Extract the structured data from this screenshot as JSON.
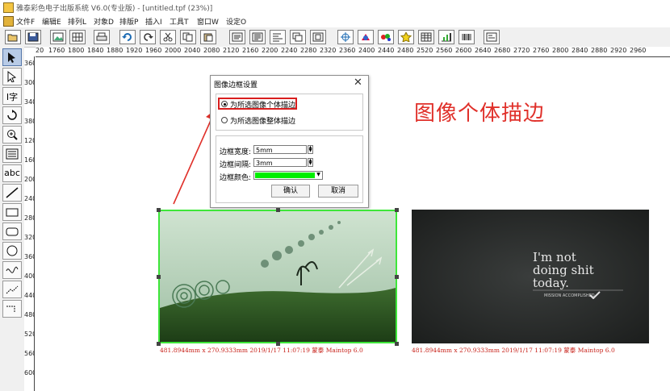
{
  "window": {
    "title": "雅泰彩色电子出版系统 V6.0(专业版) - [untitled.tpf (23%)]"
  },
  "menu": [
    "文件F",
    "编辑E",
    "排列L",
    "对象D",
    "排版P",
    "插入I",
    "工具T",
    "窗口W",
    "设定O"
  ],
  "toolbar": {
    "icons": [
      "open-folder-icon",
      "save-icon",
      "image-icon",
      "grid-icon",
      "print-icon",
      "undo-icon",
      "redo-icon",
      "cut-icon",
      "copy-icon",
      "paste-icon",
      "text-frame-icon",
      "text-flow-icon",
      "align-icon",
      "layers-icon",
      "group-icon",
      "crosshair-icon",
      "color-wheel-icon",
      "palette-icon",
      "star-icon",
      "table-icon",
      "chart-icon",
      "barcode-icon",
      "preview-icon"
    ]
  },
  "ruler": {
    "horizontal": [
      "20",
      "1760",
      "1800",
      "1840",
      "1880",
      "1920",
      "1960",
      "2000",
      "2040",
      "2080",
      "2120",
      "2160",
      "2200",
      "2240",
      "2280",
      "2320",
      "2360",
      "2400",
      "2440",
      "2480",
      "2520",
      "2560",
      "2600",
      "2640",
      "2680",
      "2720",
      "2760",
      "2800",
      "2840",
      "2880",
      "2920",
      "2960"
    ],
    "vertical": [
      "360",
      "300",
      "340",
      "380",
      "120",
      "160",
      "200",
      "240",
      "280",
      "320",
      "360",
      "400",
      "440",
      "480",
      "520",
      "560",
      "600"
    ]
  },
  "tools": {
    "text_tool_label": "abc",
    "type_tool_label": "I字"
  },
  "dialog": {
    "title": "图像边框设置",
    "close_glyph": "✕",
    "option1": "为所选图像个体描边",
    "option2": "为所选图像整体描边",
    "width_label": "边框宽度:",
    "width_value": "5mm",
    "spacing_label": "边框间隔:",
    "spacing_value": "3mm",
    "color_label": "边框颜色:",
    "color_value": "#00ee00",
    "ok_label": "确认",
    "cancel_label": "取消"
  },
  "annotation": {
    "text": "图像个体描边",
    "color": "#e0302a"
  },
  "canvas": {
    "caption1": "481.8944mm x 270.9333mm 2019/1/17 11:07:19 蒙泰 Maintop 6.0",
    "caption2": "481.8944mm x 270.9333mm 2019/1/17 11:07:19 蒙泰 Maintop 6.0",
    "slogan_line1": "I'm not",
    "slogan_line2": "doing shit",
    "slogan_line3": "today.",
    "slogan_small": "MISSION ACCOMPLISHED"
  },
  "colors": {
    "border_green": "#3ee63a",
    "caption_red": "#c8221a",
    "highlight_red": "#d81e1e"
  }
}
